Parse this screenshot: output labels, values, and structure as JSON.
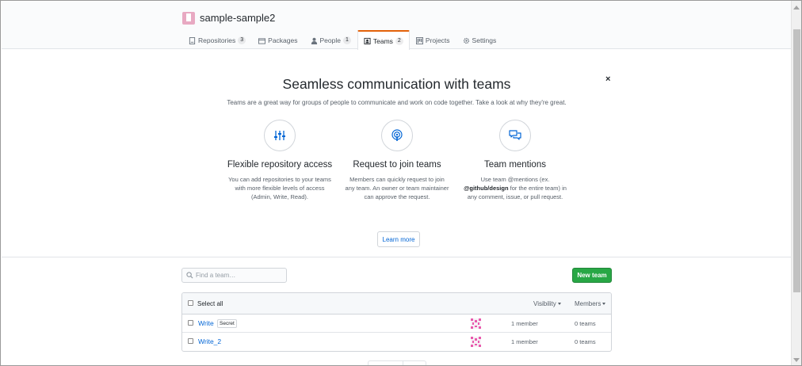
{
  "org": {
    "name": "sample-sample2"
  },
  "tabs": [
    {
      "label": "Repositories",
      "count": "3",
      "icon": "repo-icon"
    },
    {
      "label": "Packages",
      "count": "",
      "icon": "package-icon"
    },
    {
      "label": "People",
      "count": "1",
      "icon": "person-icon"
    },
    {
      "label": "Teams",
      "count": "2",
      "icon": "team-icon",
      "selected": true
    },
    {
      "label": "Projects",
      "count": "",
      "icon": "project-icon"
    },
    {
      "label": "Settings",
      "count": "",
      "icon": "gear-icon"
    }
  ],
  "promo": {
    "close": "×",
    "title": "Seamless communication with teams",
    "lead": "Teams are a great way for groups of people to communicate and work on code together. Take a look at why they're great.",
    "features": [
      {
        "icon": "sliders-icon",
        "title": "Flexible repository access",
        "desc": "You can add repositories to your teams with more flexible levels of access (Admin, Write, Read)."
      },
      {
        "icon": "broadcast-icon",
        "title": "Request to join teams",
        "desc": "Members can quickly request to join any team. An owner or team maintainer can approve the request."
      },
      {
        "icon": "comment-discussion-icon",
        "title": "Team mentions",
        "desc_prefix": "Use team @mentions (ex. ",
        "desc_bold": "@github/design",
        "desc_suffix": " for the entire team) in any comment, issue, or pull request."
      }
    ],
    "learn_more": "Learn more"
  },
  "search": {
    "placeholder": "Find a team…"
  },
  "new_team": "New team",
  "list": {
    "select_all": "Select all",
    "visibility": "Visibility",
    "members": "Members",
    "teams": [
      {
        "name": "Write",
        "label": "Secret",
        "members": "1 member",
        "subteams": "0 teams"
      },
      {
        "name": "Write_2",
        "label": "",
        "members": "1 member",
        "subteams": "0 teams"
      }
    ]
  },
  "colors": {
    "accent": "#e36209",
    "primary_button": "#28a745",
    "link": "#0366d6",
    "avatar": "#e85aad"
  }
}
